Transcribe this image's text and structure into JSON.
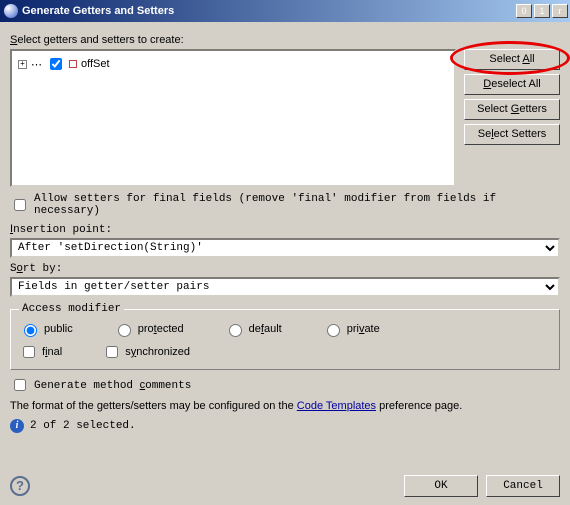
{
  "title": "Generate Getters and Setters",
  "labels": {
    "select_to_create": "Select getters and setters to create:",
    "allow_setters_final": "Allow setters for final fields (remove 'final' modifier from fields if necessary)",
    "insertion_point": "Insertion point:",
    "sort_by": "Sort by:",
    "access_modifier": "Access modifier",
    "generate_comments": "Generate method comments",
    "format_prefix": "The format of the getters/setters may be configured on the ",
    "format_link": "Code Templates",
    "format_suffix": " preference page.",
    "status": "2 of 2 selected."
  },
  "tree": {
    "item": "offSet"
  },
  "buttons": {
    "select_all": "Select All",
    "deselect_all": "Deselect All",
    "select_getters": "Select Getters",
    "select_setters": "Select Setters",
    "ok": "OK",
    "cancel": "Cancel"
  },
  "insertion_point_value": "After 'setDirection(String)'",
  "sort_by_value": "Fields in getter/setter pairs",
  "access": {
    "public": "public",
    "protected": "protected",
    "default": "default",
    "private": "private",
    "final": "final",
    "synchronized": "synchronized"
  }
}
